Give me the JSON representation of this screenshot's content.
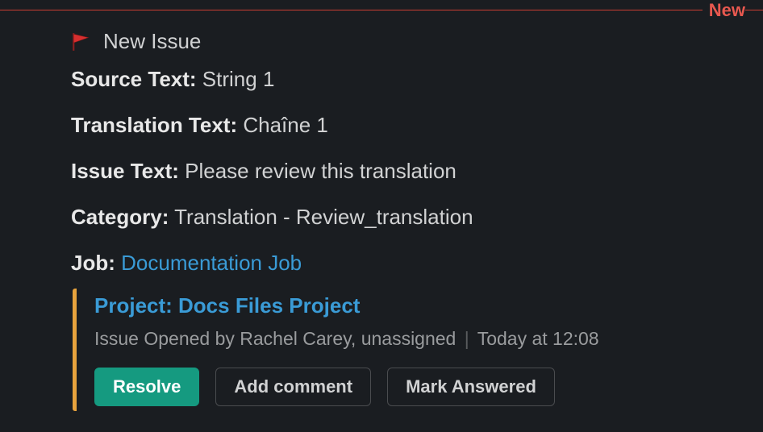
{
  "divider": {
    "label": "New"
  },
  "issue": {
    "title": "New Issue",
    "fields": {
      "source_label": "Source Text:",
      "source_value": "String 1",
      "translation_label": "Translation Text:",
      "translation_value": "Chaîne 1",
      "issue_label": "Issue Text:",
      "issue_value": "Please review this translation",
      "category_label": "Category:",
      "category_value": "Translation - Review_translation",
      "job_label": "Job:",
      "job_link": "Documentation Job"
    }
  },
  "attachment": {
    "project_link": "Project: Docs Files Project",
    "opened_by": "Issue Opened by Rachel Carey, unassigned",
    "timestamp": "Today at 12:08"
  },
  "buttons": {
    "resolve": "Resolve",
    "add_comment": "Add comment",
    "mark_answered": "Mark Answered"
  }
}
